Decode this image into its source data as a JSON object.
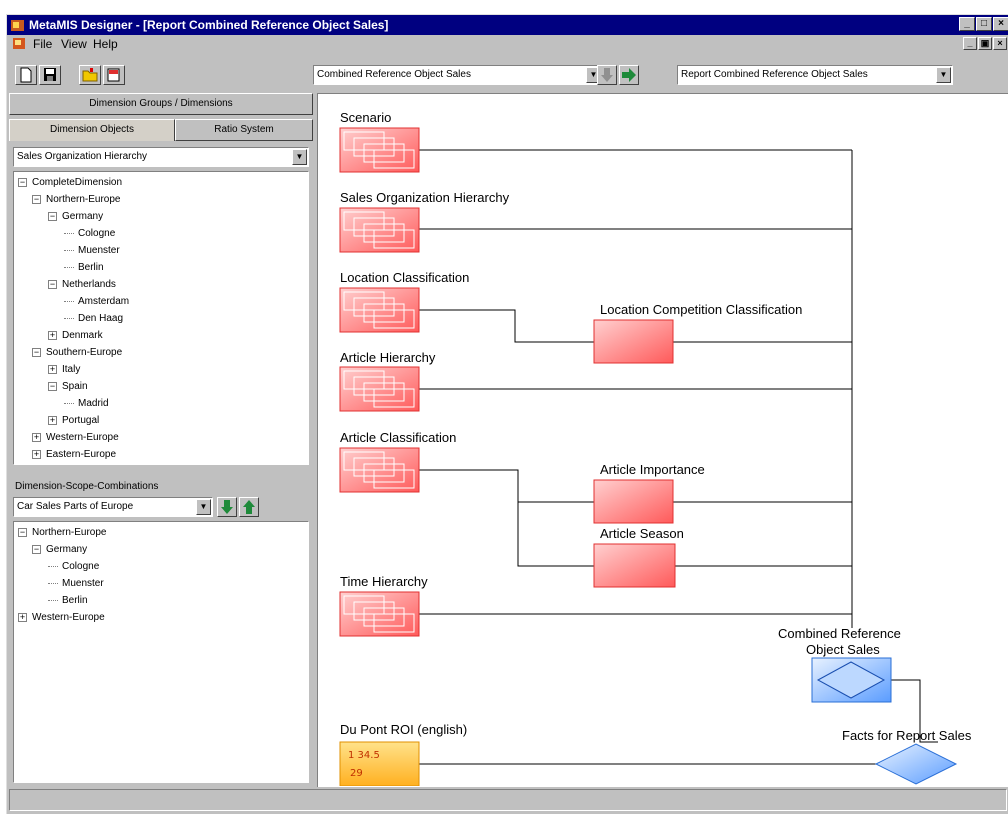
{
  "window": {
    "title": "MetaMIS Designer - [Report Combined Reference Object Sales]",
    "controls": {
      "minimize": "_",
      "maximize": "□",
      "close": "×"
    },
    "mdi_controls": {
      "minimize": "_",
      "restore": "▣",
      "close": "×"
    }
  },
  "menu": {
    "file": "File",
    "view": "View",
    "help": "Help"
  },
  "toolbar": {
    "object_combo": "Combined Reference Object Sales",
    "report_combo": "Report Combined Reference Object Sales",
    "arrow": "▼"
  },
  "left": {
    "groups_button": "Dimension Groups / Dimensions",
    "tab_objects": "Dimension Objects",
    "tab_ratio": "Ratio System",
    "hierarchy_select": "Sales Organization Hierarchy",
    "tree": [
      {
        "label": "CompleteDimension",
        "expander": "−"
      },
      {
        "label": "Northern-Europe",
        "expander": "−"
      },
      {
        "label": "Germany",
        "expander": "−"
      },
      {
        "label": "Cologne",
        "expander": ""
      },
      {
        "label": "Muenster",
        "expander": ""
      },
      {
        "label": "Berlin",
        "expander": ""
      },
      {
        "label": "Netherlands",
        "expander": "−"
      },
      {
        "label": "Amsterdam",
        "expander": ""
      },
      {
        "label": "Den Haag",
        "expander": ""
      },
      {
        "label": "Denmark",
        "expander": "+"
      },
      {
        "label": "Southern-Europe",
        "expander": "−"
      },
      {
        "label": "Italy",
        "expander": "+"
      },
      {
        "label": "Spain",
        "expander": "−"
      },
      {
        "label": "Madrid",
        "expander": ""
      },
      {
        "label": "Portugal",
        "expander": "+"
      },
      {
        "label": "Western-Europe",
        "expander": "+"
      },
      {
        "label": "Eastern-Europe",
        "expander": "+"
      }
    ],
    "scope_label": "Dimension-Scope-Combinations",
    "scope_select": "Car Sales Parts of Europe",
    "scope_tree": [
      {
        "label": "Northern-Europe",
        "expander": "−"
      },
      {
        "label": "Germany",
        "expander": "−"
      },
      {
        "label": "Cologne",
        "expander": ""
      },
      {
        "label": "Muenster",
        "expander": ""
      },
      {
        "label": "Berlin",
        "expander": ""
      },
      {
        "label": "Western-Europe",
        "expander": "+"
      }
    ]
  },
  "diagram": {
    "scenario": "Scenario",
    "sales_org": "Sales Organization Hierarchy",
    "location_class": "Location Classification",
    "location_comp": "Location Competition Classification",
    "article_hier": "Article Hierarchy",
    "article_class": "Article Classification",
    "article_importance": "Article Importance",
    "article_season": "Article Season",
    "time_hier": "Time Hierarchy",
    "combined_ref_1": "Combined Reference",
    "combined_ref_2": "Object Sales",
    "dupont": "Du Pont ROI (english)",
    "facts": "Facts for Report Sales",
    "dupont_icon_a": "1   34.5",
    "dupont_icon_b": "29",
    "colors": {
      "dimension": "#ff7b7b",
      "facts": "#7fb3ff",
      "ratio": "#ffb84d"
    }
  }
}
